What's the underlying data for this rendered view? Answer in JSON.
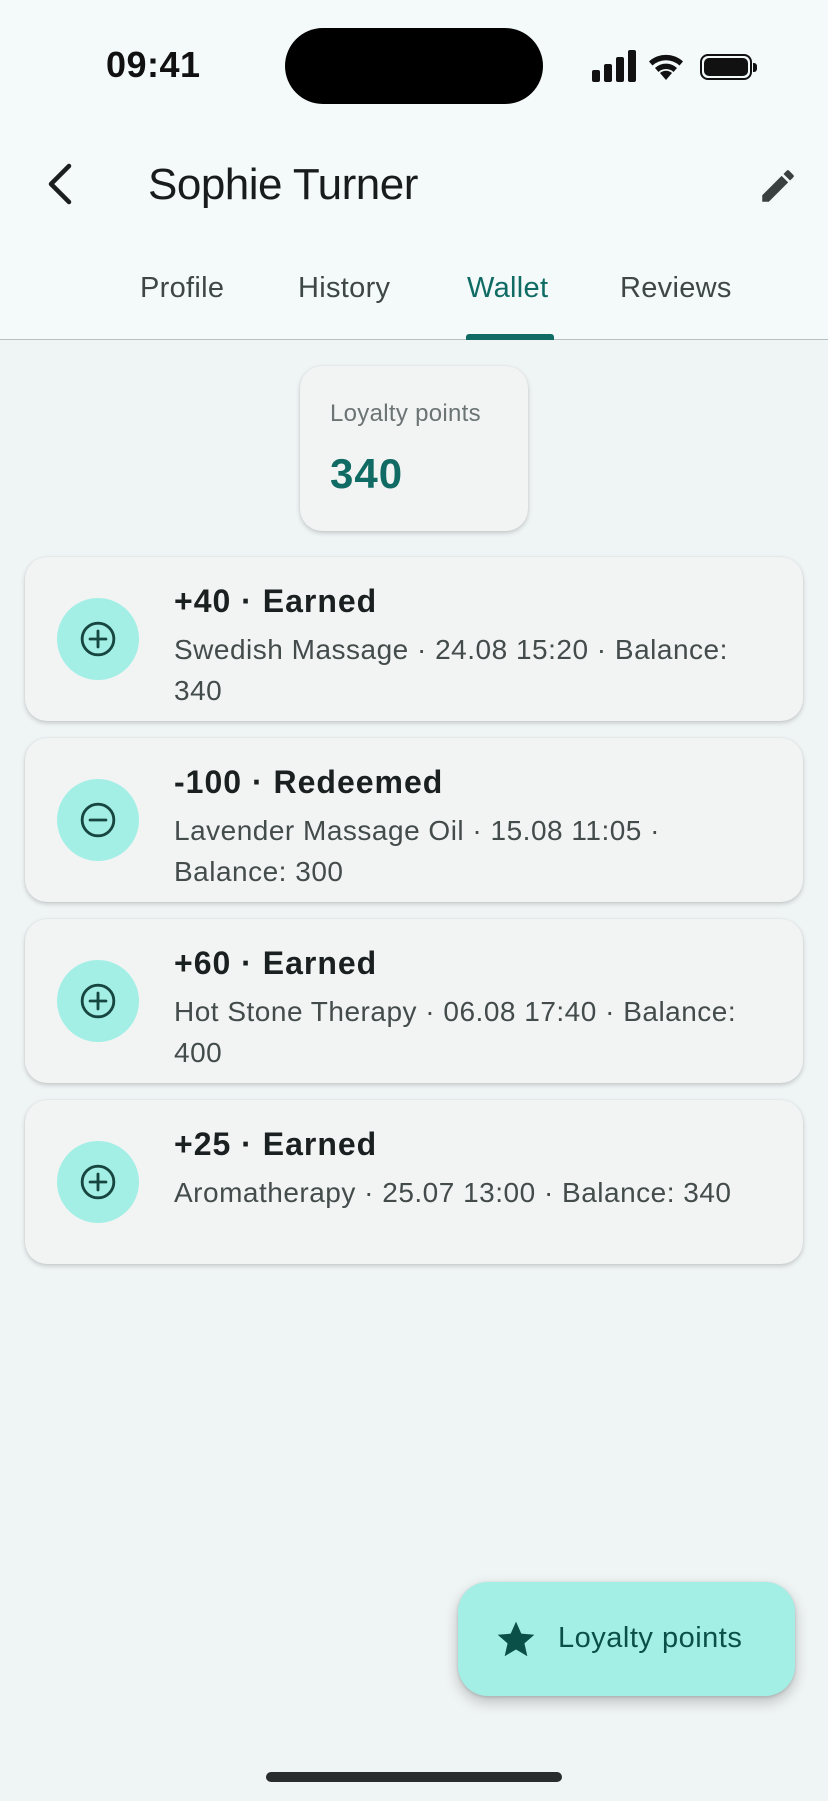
{
  "status_bar": {
    "time": "09:41"
  },
  "app_bar": {
    "title": "Sophie Turner"
  },
  "tabs": [
    {
      "label": "Profile",
      "active": false
    },
    {
      "label": "History",
      "active": false
    },
    {
      "label": "Wallet",
      "active": true
    },
    {
      "label": "Reviews",
      "active": false
    }
  ],
  "summary": {
    "label": "Loyalty points",
    "value": "340"
  },
  "transactions": [
    {
      "icon": "plus-circle-icon",
      "title": "+40 · Earned",
      "detail": "Swedish Massage · 24.08 15:20 · Balance: 340"
    },
    {
      "icon": "minus-circle-icon",
      "title": "-100 · Redeemed",
      "detail": "Lavender Massage Oil · 15.08 11:05 · Balance: 300"
    },
    {
      "icon": "plus-circle-icon",
      "title": "+60 · Earned",
      "detail": "Hot Stone Therapy · 06.08 17:40 · Balance: 400"
    },
    {
      "icon": "plus-circle-icon",
      "title": "+25 · Earned",
      "detail": "Aromatherapy · 25.07 13:00 · Balance: 340"
    }
  ],
  "fab": {
    "label": "Loyalty points",
    "icon": "star-icon"
  },
  "colors": {
    "accent": "#0f6b63",
    "icon_bg": "#a3efe5",
    "background": "#eff4f4"
  }
}
